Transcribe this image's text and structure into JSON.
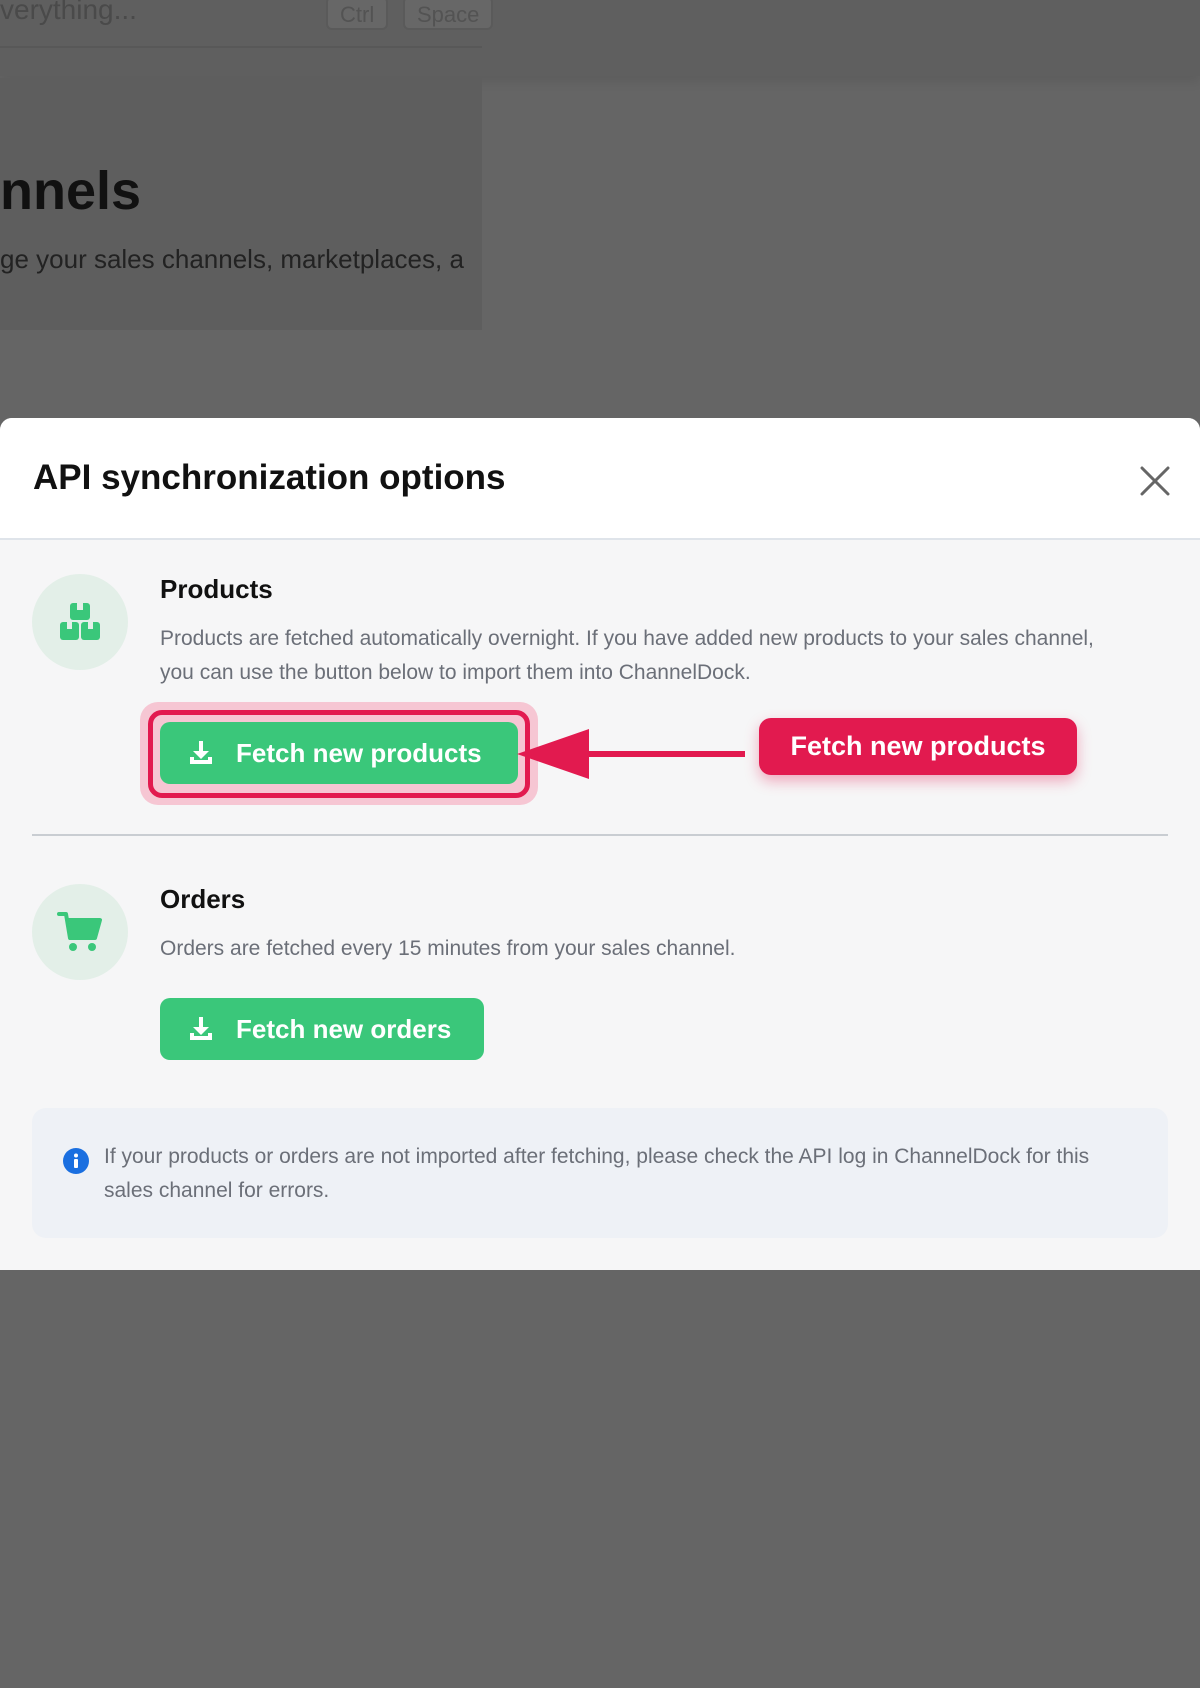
{
  "background": {
    "search_placeholder": "verything...",
    "kbd_ctrl": "Ctrl",
    "kbd_space": "Space",
    "page_title": "nnels",
    "page_subtitle": "ge your sales channels, marketplaces, a"
  },
  "modal": {
    "title": "API synchronization options",
    "close_icon": "close-icon",
    "products": {
      "icon": "boxes-icon",
      "title": "Products",
      "description": "Products are fetched automatically overnight. If you have added new products to your sales channel, you can use the button below to import them into ChannelDock.",
      "button_label": "Fetch new products",
      "button_icon": "download-icon"
    },
    "orders": {
      "icon": "cart-icon",
      "title": "Orders",
      "description": "Orders are fetched every 15 minutes from your sales channel.",
      "button_label": "Fetch new orders",
      "button_icon": "download-icon"
    },
    "info": {
      "icon": "info-icon",
      "text": "If your products or orders are not imported after fetching, please check the API log in ChannelDock for this sales channel for errors."
    }
  },
  "annotation": {
    "callout_label": "Fetch new products"
  },
  "colors": {
    "accent_green": "#3ac77a",
    "highlight_red": "#e21a4f",
    "overlay": "#656565"
  }
}
